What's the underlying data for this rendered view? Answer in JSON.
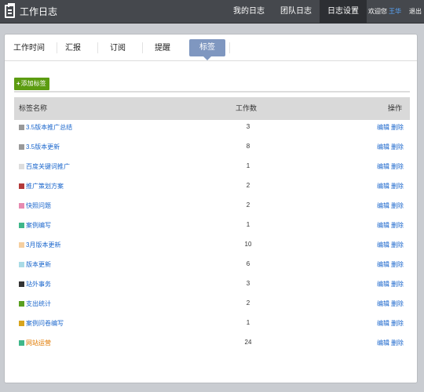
{
  "app": {
    "title": "工作日志",
    "nav": [
      "我的日志",
      "团队日志",
      "日志设置"
    ],
    "active_nav": 2,
    "welcome": "欢迎您",
    "username": "王华",
    "logout": "退出"
  },
  "tabs": [
    "工作时间",
    "汇报",
    "订阅",
    "提醒",
    "标签"
  ],
  "active_tab": 4,
  "toolbar": {
    "add_label": "添加标签",
    "add_icon": "plus-icon"
  },
  "table": {
    "headers": {
      "name": "标签名称",
      "count": "工作数",
      "action": "操作"
    },
    "rows": [
      {
        "color": "#999999",
        "name": "3.5版本推广总结",
        "count": "3",
        "edit": "编辑",
        "delete": "删除"
      },
      {
        "color": "#999999",
        "name": "3.5版本更新",
        "count": "8",
        "edit": "编辑",
        "delete": "删除"
      },
      {
        "color": "#dddddd",
        "name": "百度关键词推广",
        "count": "1",
        "edit": "编辑",
        "delete": "删除"
      },
      {
        "color": "#b33a3a",
        "name": "推广策划方案",
        "count": "2",
        "edit": "编辑",
        "delete": "删除"
      },
      {
        "color": "#e68ab0",
        "name": "快照问题",
        "count": "2",
        "edit": "编辑",
        "delete": "删除"
      },
      {
        "color": "#3fb78a",
        "name": "案例编写",
        "count": "1",
        "edit": "编辑",
        "delete": "删除"
      },
      {
        "color": "#f5cfa0",
        "name": "3月版本更新",
        "count": "10",
        "edit": "编辑",
        "delete": "删除"
      },
      {
        "color": "#a9dbe6",
        "name": "版本更新",
        "count": "6",
        "edit": "编辑",
        "delete": "删除"
      },
      {
        "color": "#333333",
        "name": "站外事务",
        "count": "3",
        "edit": "编辑",
        "delete": "删除"
      },
      {
        "color": "#5aa020",
        "name": "支出统计",
        "count": "2",
        "edit": "编辑",
        "delete": "删除"
      },
      {
        "color": "#d8a51e",
        "name": "案例问卷编写",
        "count": "1",
        "edit": "编辑",
        "delete": "删除"
      },
      {
        "color": "#3fb78a",
        "name": "网站运营",
        "count": "24",
        "edit": "编辑",
        "delete": "删除",
        "highlight": true
      }
    ]
  }
}
